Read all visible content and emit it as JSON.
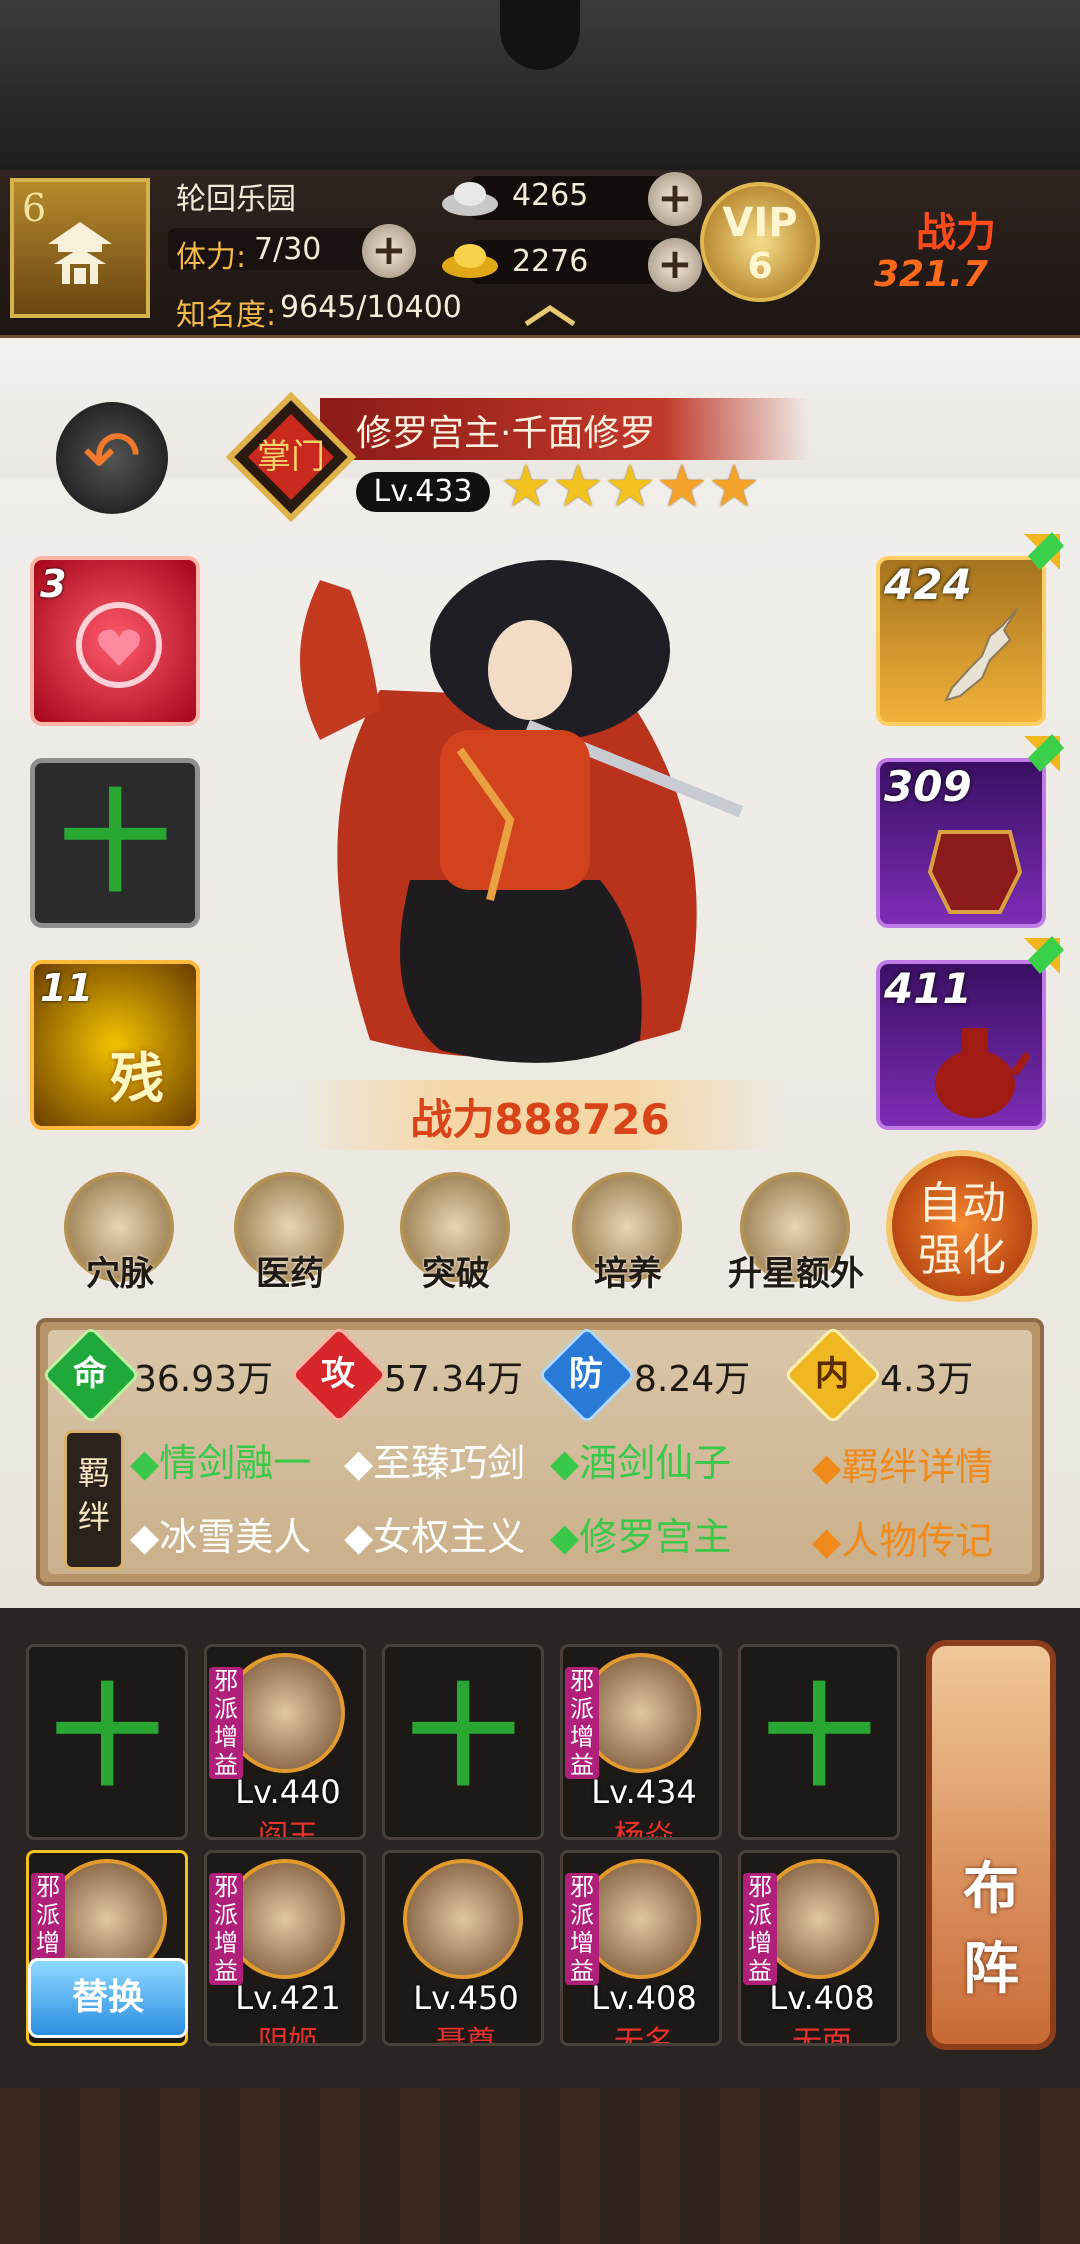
{
  "header": {
    "level": "6",
    "player_name": "轮回乐园",
    "stamina_label": "体力:",
    "stamina_value": "7/30",
    "fame_label": "知名度:",
    "fame_value": "9645/10400",
    "silver": "4265",
    "gold": "2276",
    "vip_label": "VIP",
    "vip_level": "6",
    "power_label": "战力",
    "power_value": "321.7"
  },
  "hero": {
    "name": "修罗宫主·千面修罗",
    "badge": "掌门",
    "level": "Lv.433",
    "stars": 5,
    "power_label": "战力",
    "power_value": "888726"
  },
  "left_slots": [
    {
      "count": "3"
    },
    {
      "empty": "十"
    },
    {
      "count": "11",
      "tag": "残"
    }
  ],
  "equipment": [
    {
      "level": "424"
    },
    {
      "level": "309"
    },
    {
      "level": "411"
    }
  ],
  "functions": [
    {
      "label": "穴脉"
    },
    {
      "label": "医药"
    },
    {
      "label": "突破"
    },
    {
      "label": "培养"
    },
    {
      "label": "升星额外"
    }
  ],
  "auto_button": {
    "line1": "自动",
    "line2": "强化"
  },
  "stats": {
    "life": {
      "label": "命",
      "value": "36.93万"
    },
    "attack": {
      "label": "攻",
      "value": "57.34万"
    },
    "defense": {
      "label": "防",
      "value": "8.24万"
    },
    "inner": {
      "label": "内",
      "value": "4.3万"
    }
  },
  "bonds": {
    "tag": "羁绊",
    "row1": [
      "◆情剑融一",
      "◆至臻巧剑",
      "◆酒剑仙子"
    ],
    "row2": [
      "◆冰雪美人",
      "◆女权主义",
      "◆修罗宫主"
    ],
    "detail_link": "◆羁绊详情",
    "bio_link": "◆人物传记"
  },
  "team": {
    "row1": [
      {
        "empty": "十"
      },
      {
        "level": "Lv.440",
        "name": "阎王",
        "tag": "邪派增益"
      },
      {
        "empty": "十"
      },
      {
        "level": "Lv.434",
        "name": "杨焱",
        "tag": "邪派增益"
      },
      {
        "empty": "十"
      }
    ],
    "row2": [
      {
        "tag": "邪派增益",
        "swap": "替换"
      },
      {
        "level": "Lv.421",
        "name": "阴姬",
        "tag": "邪派增益"
      },
      {
        "level": "Lv.450",
        "name": "聂尊"
      },
      {
        "level": "Lv.408",
        "name": "无名",
        "tag": "邪派增益"
      },
      {
        "level": "Lv.408",
        "name": "无面",
        "tag": "邪派增益"
      }
    ],
    "formation": "布阵"
  },
  "colors": {
    "accent_red": "#e8312c",
    "bond_green": "#39c84a",
    "link_orange": "#ef8a1b",
    "gold": "#f2c21e"
  }
}
